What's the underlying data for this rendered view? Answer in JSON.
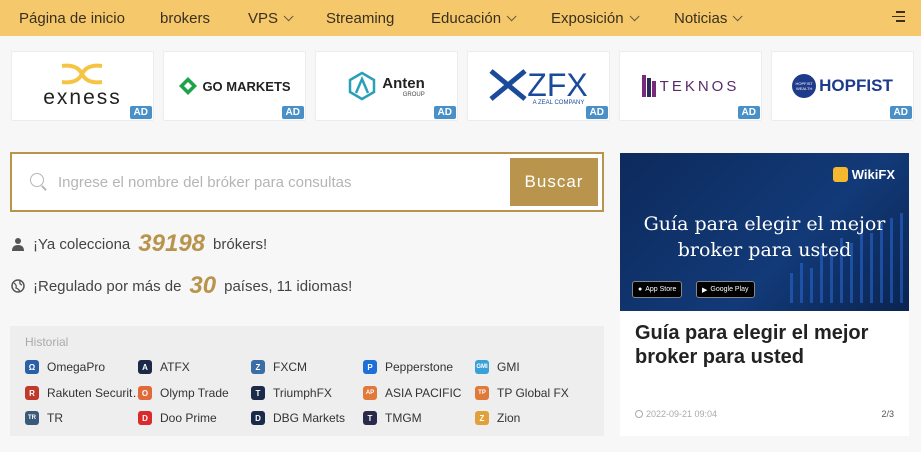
{
  "nav": {
    "items": [
      {
        "label": "Página de inicio",
        "dropdown": false
      },
      {
        "label": "brokers",
        "dropdown": false
      },
      {
        "label": "VPS",
        "dropdown": true
      },
      {
        "label": "Streaming",
        "dropdown": false
      },
      {
        "label": "Educación",
        "dropdown": true
      },
      {
        "label": "Exposición",
        "dropdown": true
      },
      {
        "label": "Noticias",
        "dropdown": true
      }
    ],
    "menu_icon": "menu-icon"
  },
  "ads": {
    "badge": "AD",
    "brokers": [
      {
        "name": "exness"
      },
      {
        "name": "GO MARKETS"
      },
      {
        "name": "Anten",
        "sub": "GROUP"
      },
      {
        "name": "ZFX",
        "sub": "A ZEAL COMPANY"
      },
      {
        "name": "TEKNOS"
      },
      {
        "name": "HOPFIST",
        "sub": "HOPFIST WEALTH"
      }
    ]
  },
  "search": {
    "placeholder": "Ingrese el nombre del bróker para consultas",
    "button": "Buscar"
  },
  "stats": {
    "brokers_prefix": "¡Ya colecciona",
    "brokers_count": "39198",
    "brokers_suffix": "brókers!",
    "regulated_prefix": "¡Regulado por más de",
    "regulated_count": "30",
    "regulated_suffix": "países, 11 idiomas!"
  },
  "history": {
    "title": "Historial",
    "items": [
      {
        "label": "OmegaPro",
        "color": "#2b5fa8",
        "glyph": "Ω"
      },
      {
        "label": "ATFX",
        "color": "#1c2a4a",
        "glyph": "A"
      },
      {
        "label": "FXCM",
        "color": "#3a6ea5",
        "glyph": "Z"
      },
      {
        "label": "Pepperstone",
        "color": "#1e6fd9",
        "glyph": "P"
      },
      {
        "label": "GMI",
        "color": "#3aa0d8",
        "glyph": "GMI"
      },
      {
        "label": "Rakuten Securit…",
        "color": "#c0392b",
        "glyph": "R"
      },
      {
        "label": "Olymp Trade",
        "color": "#e06a3a",
        "glyph": "O"
      },
      {
        "label": "TriumphFX",
        "color": "#1c2a4a",
        "glyph": "T"
      },
      {
        "label": "ASIA PACIFIC",
        "color": "#e07a3a",
        "glyph": "AP"
      },
      {
        "label": "TP Global FX",
        "color": "#e07a3a",
        "glyph": "TP"
      },
      {
        "label": "TR",
        "color": "#3a5a7a",
        "glyph": "TR"
      },
      {
        "label": "Doo Prime",
        "color": "#d92b2b",
        "glyph": "D"
      },
      {
        "label": "DBG Markets",
        "color": "#1c2a4a",
        "glyph": "D"
      },
      {
        "label": "TMGM",
        "color": "#2a2a4a",
        "glyph": "T"
      },
      {
        "label": "Zion",
        "color": "#e0a03a",
        "glyph": "Z"
      }
    ]
  },
  "side": {
    "brand": "WikiFX",
    "banner_title_line1": "Guía para elegir el mejor",
    "banner_title_line2": "broker para usted",
    "app_store": "App Store",
    "google_play": "Google Play",
    "title": "Guía para elegir el mejor broker para usted",
    "date": "2022-09-21 09:04",
    "page": "2/3"
  }
}
